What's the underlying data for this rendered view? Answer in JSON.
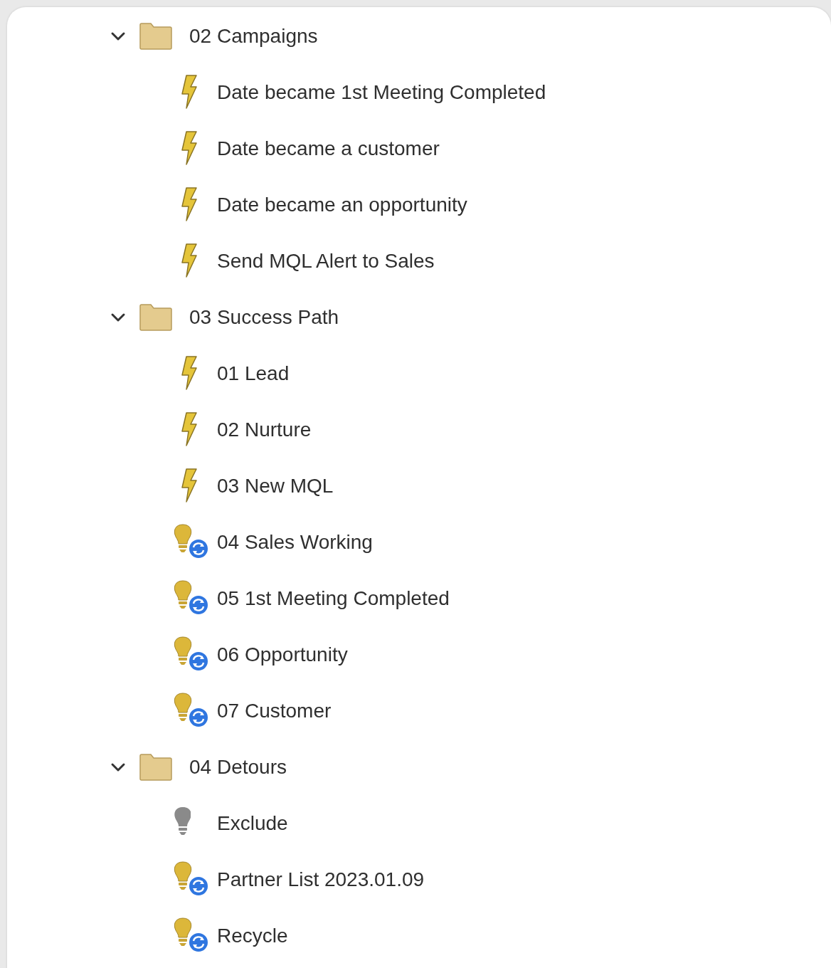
{
  "tree": [
    {
      "label": "02 Campaigns",
      "expanded": true,
      "children": [
        {
          "kind": "trigger",
          "label": "Date became 1st Meeting Completed"
        },
        {
          "kind": "trigger",
          "label": "Date became a customer"
        },
        {
          "kind": "trigger",
          "label": "Date became an opportunity"
        },
        {
          "kind": "trigger",
          "label": "Send MQL Alert to Sales"
        }
      ]
    },
    {
      "label": "03 Success Path",
      "expanded": true,
      "children": [
        {
          "kind": "trigger",
          "label": "01 Lead"
        },
        {
          "kind": "trigger",
          "label": "02 Nurture"
        },
        {
          "kind": "trigger",
          "label": "03 New MQL"
        },
        {
          "kind": "recurring",
          "label": "04 Sales Working"
        },
        {
          "kind": "recurring",
          "label": "05 1st Meeting Completed"
        },
        {
          "kind": "recurring",
          "label": "06 Opportunity"
        },
        {
          "kind": "recurring",
          "label": "07 Customer"
        }
      ]
    },
    {
      "label": "04 Detours",
      "expanded": true,
      "children": [
        {
          "kind": "inactive",
          "label": "Exclude"
        },
        {
          "kind": "recurring",
          "label": "Partner List 2023.01.09"
        },
        {
          "kind": "recurring",
          "label": "Recycle"
        }
      ]
    }
  ]
}
